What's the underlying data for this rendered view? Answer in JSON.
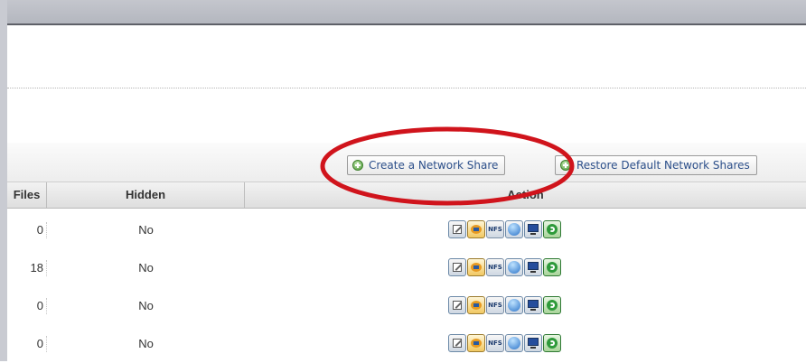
{
  "toolbar": {
    "create_label": "Create a Network Share",
    "restore_label": "Restore Default Network Shares"
  },
  "table": {
    "columns": [
      "Files",
      "Hidden",
      "Action"
    ],
    "rows": [
      {
        "files": "0",
        "hidden": "No"
      },
      {
        "files": "18",
        "hidden": "No"
      },
      {
        "files": "0",
        "hidden": "No"
      },
      {
        "files": "0",
        "hidden": "No"
      }
    ],
    "action_icons": [
      "edit-icon",
      "share-icon",
      "nfs-icon",
      "globe-icon",
      "monitor-icon",
      "refresh-icon"
    ]
  },
  "colors": {
    "annotation": "#d0141c",
    "button_text": "#2c4f8a"
  }
}
